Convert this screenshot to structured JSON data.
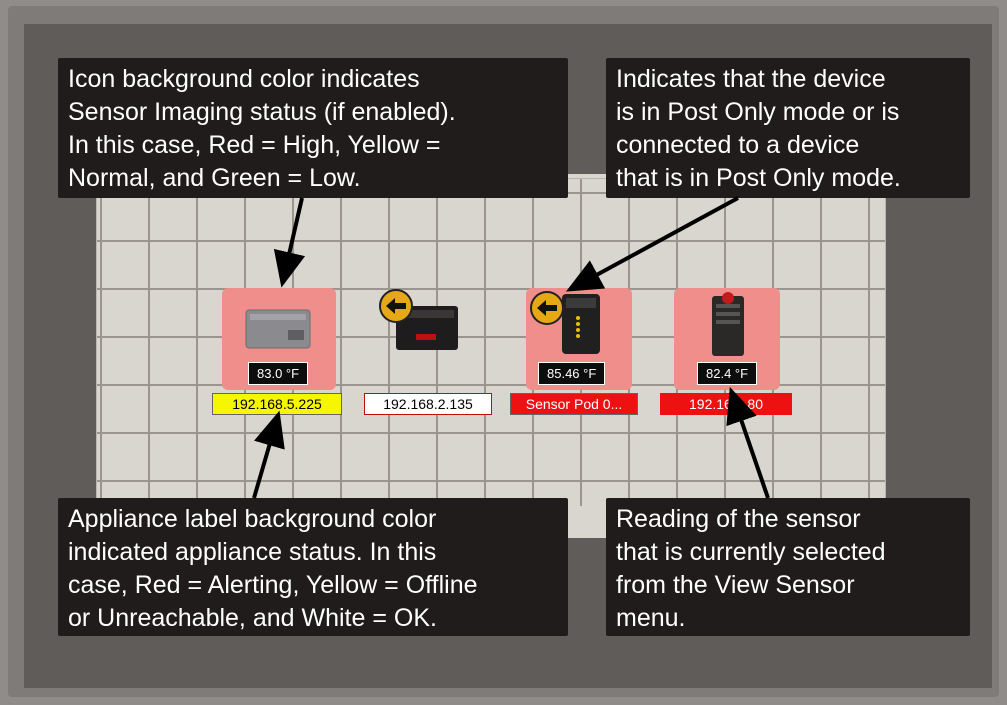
{
  "callouts": {
    "icon_bg": {
      "lines": [
        "Icon background color indicates",
        "Sensor Imaging status (if enabled).",
        "In this case, Red = High, Yellow =",
        "Normal, and Green = Low."
      ]
    },
    "post_only": {
      "lines": [
        "Indicates that the device",
        "is in Post Only mode or is",
        "connected to a device",
        "that is in Post Only mode."
      ]
    },
    "label_bg": {
      "lines": [
        "Appliance label background color",
        "indicated appliance status.  In this",
        "case, Red = Alerting, Yellow = Offline",
        "or Unreachable, and White = OK."
      ]
    },
    "reading": {
      "lines": [
        "Reading of the sensor",
        "that is currently selected",
        "from the View Sensor",
        "menu."
      ]
    }
  },
  "devices": [
    {
      "temp": "83.0 °F",
      "label": "192.168.5.225",
      "label_status": "offline",
      "icon": "gray-appliance-icon",
      "icon_bg": "red"
    },
    {
      "temp": "",
      "label": "192.168.2.135",
      "label_status": "ok",
      "icon": "black-appliance-icon",
      "post_only": true
    },
    {
      "temp": "85.46 °F",
      "label": "Sensor Pod 0...",
      "label_status": "alerting",
      "icon": "sensor-pod-icon",
      "icon_bg": "red",
      "post_only": true
    },
    {
      "temp": "82.4 °F",
      "label": "192.16  4.80",
      "label_status": "alerting",
      "icon": "tower-appliance-icon",
      "icon_bg": "red"
    }
  ],
  "colors": {
    "icon_bg_red": "#ef8e8b",
    "label_yellow": "#f6f600",
    "label_white": "#ffffff",
    "label_red": "#ee1111",
    "post_only_badge": "#e6a817"
  }
}
